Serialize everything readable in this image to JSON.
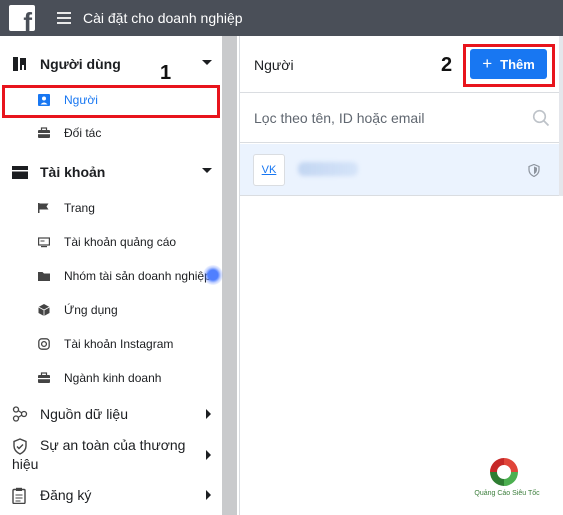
{
  "app": {
    "logo_letter": "f",
    "title": "Cài đặt cho doanh nghiệp"
  },
  "sidebar": {
    "groups": [
      {
        "label": "Người dùng",
        "icon": "users-icon"
      },
      {
        "label": "Tài khoản",
        "icon": "briefcase-icon"
      }
    ],
    "users_items": [
      {
        "label": "Người",
        "icon": "person-icon",
        "active": true
      },
      {
        "label": "Đối tác",
        "icon": "partners-icon",
        "active": false
      }
    ],
    "account_items": [
      {
        "label": "Trang",
        "icon": "flag-icon"
      },
      {
        "label": "Tài khoản quảng cáo",
        "icon": "ad-account-icon"
      },
      {
        "label": "Nhóm tài sản doanh nghiệp",
        "icon": "folder-icon"
      },
      {
        "label": "Ứng dụng",
        "icon": "cube-icon"
      },
      {
        "label": "Tài khoản Instagram",
        "icon": "instagram-icon"
      },
      {
        "label": "Ngành kinh doanh",
        "icon": "briefcase-icon"
      }
    ],
    "other_groups": [
      {
        "label": "Nguồn dữ liệu",
        "icon": "data-sources-icon"
      },
      {
        "label": "Sự an toàn của thương",
        "label_line2": "hiệu",
        "icon": "shield-icon"
      },
      {
        "label": "Đăng ký",
        "icon": "clipboard-icon"
      }
    ]
  },
  "annotations": {
    "step1": "1",
    "step2": "2"
  },
  "main": {
    "title": "Người",
    "add_button": {
      "plus": "+",
      "label": "Thêm"
    },
    "search": {
      "placeholder": "Lọc theo tên, ID hoặc email",
      "value": ""
    },
    "people": [
      {
        "initials": "VK"
      }
    ]
  },
  "watermark": {
    "text": "Quảng Cáo Siêu Tốc"
  },
  "colors": {
    "topbar": "#4a4f58",
    "accent": "#1877f2",
    "highlight_box": "#e8141c",
    "selected_row": "#ebf3fe"
  }
}
